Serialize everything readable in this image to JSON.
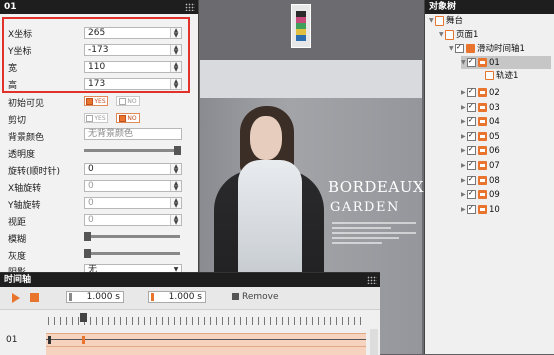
{
  "properties_panel": {
    "title": "01",
    "fields": [
      {
        "label": "X坐标",
        "value": "265"
      },
      {
        "label": "Y坐标",
        "value": "-173"
      },
      {
        "label": "宽",
        "value": "110"
      },
      {
        "label": "高",
        "value": "173"
      }
    ],
    "initial_visible": {
      "label": "初始可见",
      "yes": "YES",
      "no": "NO",
      "selected": "YES"
    },
    "clip": {
      "label": "剪切",
      "yes": "YES",
      "no": "NO",
      "selected": "NO"
    },
    "bg_color": {
      "label": "背景颜色",
      "value": "无背景颜色"
    },
    "opacity": {
      "label": "透明度"
    },
    "rotation": {
      "label": "旋转(顺时针)",
      "value": "0"
    },
    "x_rotation": {
      "label": "X轴旋转",
      "value": "0"
    },
    "y_rotation": {
      "label": "Y轴旋转",
      "value": "0"
    },
    "perspective": {
      "label": "视距",
      "value": "0"
    },
    "blur": {
      "label": "模糊"
    },
    "grayscale": {
      "label": "灰度"
    },
    "shadow": {
      "label": "阴影",
      "value": "无"
    }
  },
  "timeline": {
    "title": "时间轴",
    "time_start": "1.000 s",
    "time_end": "1.000 s",
    "remove_label": "Remove",
    "track_label": "01"
  },
  "stage": {
    "brand_line1": "BORDEAUX",
    "brand_line2": "GARDEN"
  },
  "object_tree": {
    "title": "对象树",
    "root": "舞台",
    "page": "页面1",
    "scroller": "滑动时间轴1",
    "selected_item": "01",
    "track_item": "轨迹1",
    "items": [
      "02",
      "03",
      "04",
      "05",
      "06",
      "07",
      "08",
      "09",
      "10"
    ]
  },
  "colors": {
    "accent": "#e8742e",
    "highlight": "#e0312b",
    "titlebar": "#1e1e1e"
  }
}
